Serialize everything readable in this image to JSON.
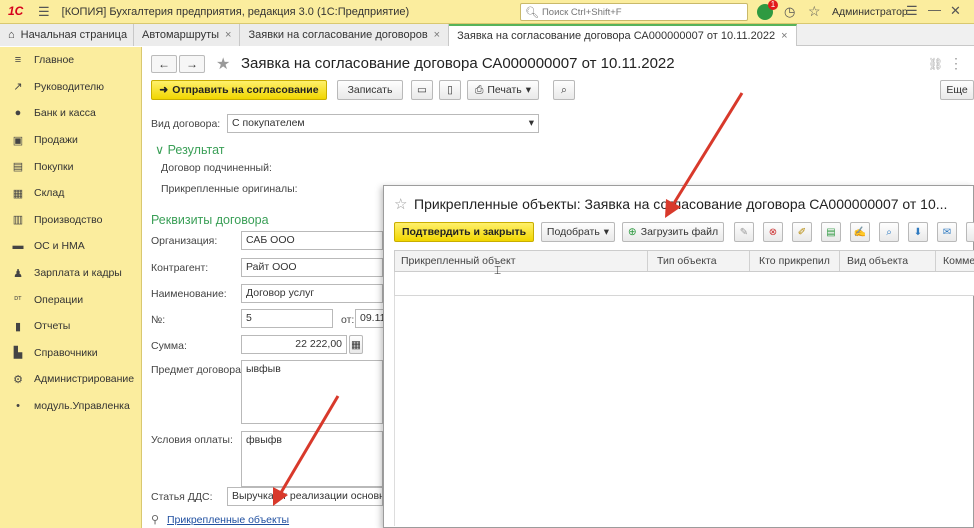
{
  "app": {
    "title": "[КОПИЯ] Бухгалтерия предприятия, редакция 3.0  (1С:Предприятие)",
    "logo_text": "1С",
    "search_placeholder": "Поиск Ctrl+Shift+F",
    "notification_count": "1",
    "user": "Администратор"
  },
  "tabs": [
    {
      "label": "Начальная страница"
    },
    {
      "label": "Автомаршруты"
    },
    {
      "label": "Заявки на согласование договоров"
    },
    {
      "label": "Заявка на согласование договора СА000000007 от 10.11.2022"
    }
  ],
  "sidebar": {
    "items": [
      {
        "label": "Главное",
        "icon": "menu-icon"
      },
      {
        "label": "Руководителю",
        "icon": "trend-icon"
      },
      {
        "label": "Банк и касса",
        "icon": "coin-icon"
      },
      {
        "label": "Продажи",
        "icon": "cart-icon"
      },
      {
        "label": "Покупки",
        "icon": "basket-icon"
      },
      {
        "label": "Склад",
        "icon": "grid-icon"
      },
      {
        "label": "Производство",
        "icon": "factory-icon"
      },
      {
        "label": "ОС и НМА",
        "icon": "truck-icon"
      },
      {
        "label": "Зарплата и кадры",
        "icon": "person-icon"
      },
      {
        "label": "Операции",
        "icon": "dtkt-icon"
      },
      {
        "label": "Отчеты",
        "icon": "bar-chart-icon"
      },
      {
        "label": "Справочники",
        "icon": "book-icon"
      },
      {
        "label": "Администрирование",
        "icon": "gear-icon"
      },
      {
        "label": "модуль.Управленка",
        "icon": "dot-icon"
      }
    ]
  },
  "document": {
    "title": "Заявка на согласование договора СА000000007 от 10.11.2022",
    "toolbar": {
      "send": "Отправить на согласование",
      "save": "Записать",
      "print": "Печать",
      "more": "Еще"
    },
    "contract_type_label": "Вид договора:",
    "contract_type_value": "С покупателем",
    "result_section": "Результат",
    "subordinate_label": "Договор подчиненный:",
    "originals_label": "Прикрепленные оригиналы:",
    "details_section": "Реквизиты договора",
    "org_label": "Организация:",
    "org_value": "САБ ООО",
    "counterparty_label": "Контрагент:",
    "counterparty_value": "Райт ООО",
    "name_label": "Наименование:",
    "name_value": "Договор услуг",
    "number_label": "№:",
    "number_value": "5",
    "date_label": "от:",
    "date_value": "09.11",
    "sum_label": "Сумма:",
    "sum_value": "22 222,00",
    "subject_label": "Предмет договора:",
    "subject_value": "ывфыв",
    "payment_label": "Условия оплаты:",
    "payment_value": "фвыфв",
    "dds_label": "Статья ДДС:",
    "dds_value": "Выручка от реализации основной",
    "attached_link": "Прикрепленные объекты"
  },
  "dialog": {
    "title": "Прикрепленные объекты: Заявка на согласование договора СА000000007 от 10...",
    "confirm": "Подтвердить и закрыть",
    "select": "Подобрать",
    "upload": "Загрузить файл",
    "columns": [
      "Прикрепленный объект",
      "Тип объекта",
      "Кто прикрепил",
      "Вид объекта",
      "Комме"
    ]
  },
  "colors": {
    "accent_yellow": "#fbed9e",
    "button_yellow": "#f1d600",
    "section_green": "#3a9f57",
    "arrow_red": "#d8392b"
  }
}
